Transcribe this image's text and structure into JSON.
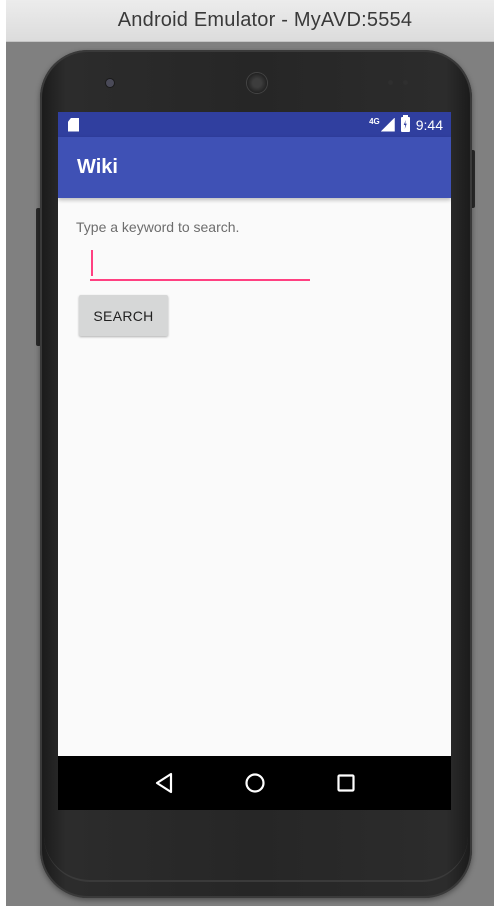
{
  "window": {
    "title": "Android Emulator - MyAVD:5554"
  },
  "status_bar": {
    "network_label": "4G",
    "time": "9:44"
  },
  "app_bar": {
    "title": "Wiki"
  },
  "content": {
    "prompt": "Type a keyword to search.",
    "search_value": "",
    "search_button_label": "SEARCH"
  },
  "nav_bar": {
    "icons": [
      "back-icon",
      "home-icon",
      "recents-icon"
    ]
  },
  "colors": {
    "status_bar": "#303f9f",
    "app_bar": "#3f51b5",
    "accent": "#ff4081",
    "button": "#d6d7d7",
    "screen_background": "#fafafa",
    "emulator_background": "#808080"
  }
}
